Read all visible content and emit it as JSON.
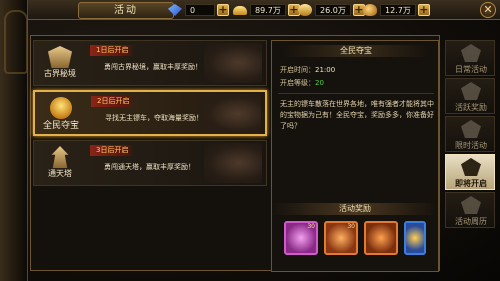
{
  "header": {
    "title": "活动",
    "currencies": [
      {
        "icon": "diamond-icon",
        "value": "0"
      },
      {
        "icon": "gold-ingot-icon",
        "value": "89.7万"
      },
      {
        "icon": "bound-ingot-icon",
        "value": "26.0万"
      },
      {
        "icon": "coin-bag-icon",
        "value": "12.7万"
      }
    ]
  },
  "activities": [
    {
      "name": "古界秘境",
      "ribbon": "1日后开启",
      "desc": "勇闯古界秘境，赢取丰厚奖励！",
      "icon": "ancient-realm-icon"
    },
    {
      "name": "全民夺宝",
      "ribbon": "2日后开启",
      "desc": "寻找无主镖车，夺取海量奖励！",
      "icon": "treasure-hunt-icon"
    },
    {
      "name": "通天塔",
      "ribbon": "3日后开启",
      "desc": "勇闯通天塔，赢取丰厚奖励！",
      "icon": "sky-tower-icon"
    }
  ],
  "detail": {
    "title": "全民夺宝",
    "time_label": "开启时间：",
    "time_value": "21:00",
    "level_label": "开启等级：",
    "level_value": "20",
    "description": "无主的镖车散落在世界各地，唯有强者才能将其中的宝物据为己有！全民夺宝，奖励多多，你准备好了吗？",
    "reward_title": "活动奖励",
    "rewards": [
      {
        "icon": "pink-gem-reward-icon",
        "count": "30"
      },
      {
        "icon": "orange-relic-reward-icon",
        "count": "30"
      },
      {
        "icon": "orange-orb-reward-icon",
        "count": ""
      },
      {
        "icon": "treasure-chest-reward-icon",
        "count": ""
      }
    ]
  },
  "tabs": [
    {
      "label": "日常活动",
      "icon": "daily-icon"
    },
    {
      "label": "活跃奖励",
      "icon": "active-reward-icon"
    },
    {
      "label": "限时活动",
      "icon": "timed-icon"
    },
    {
      "label": "即将开启",
      "icon": "upcoming-icon"
    },
    {
      "label": "活动周历",
      "icon": "calendar-icon"
    }
  ]
}
